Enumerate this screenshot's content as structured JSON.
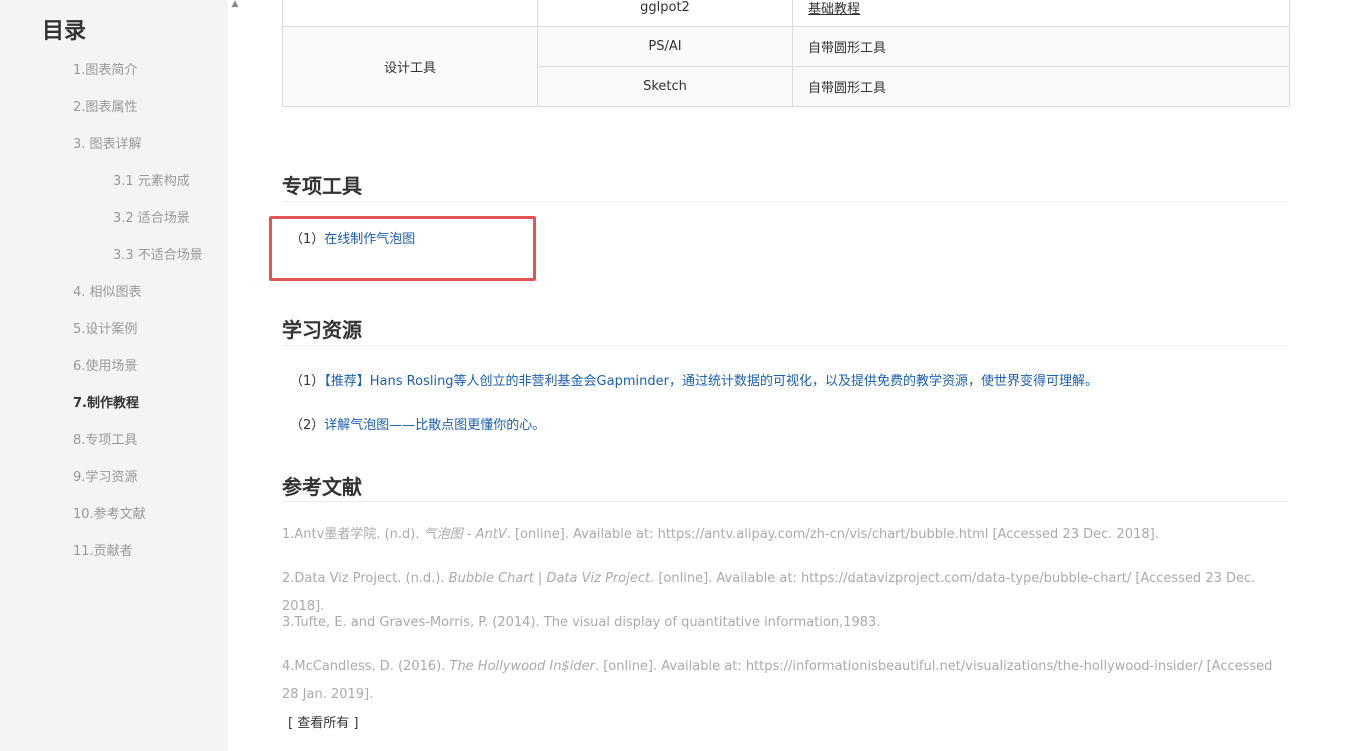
{
  "sidebar": {
    "title": "目录",
    "items": [
      {
        "label": "1.图表简介"
      },
      {
        "label": "2.图表属性"
      },
      {
        "label": "3. 图表详解"
      },
      {
        "label": "3.1 元素构成"
      },
      {
        "label": "3.2 适合场景"
      },
      {
        "label": "3.3 不适合场景"
      },
      {
        "label": "4. 相似图表"
      },
      {
        "label": "5.设计案例"
      },
      {
        "label": "6.使用场景"
      },
      {
        "label": "7.制作教程"
      },
      {
        "label": "8.专项工具"
      },
      {
        "label": "9.学习资源"
      },
      {
        "label": "10.参考文献"
      },
      {
        "label": "11.贡献者"
      }
    ],
    "scroll_up_glyph": "▲"
  },
  "tools_table": {
    "rows": [
      {
        "category": "",
        "tool": "gglpot2",
        "resource": "基础教程"
      },
      {
        "category": "设计工具",
        "tool": "PS/AI",
        "resource": "自带圆形工具"
      },
      {
        "category": "",
        "tool": "Sketch",
        "resource": "自带圆形工具"
      }
    ]
  },
  "special_tools": {
    "heading": "专项工具",
    "items": [
      {
        "prefix": "（1）",
        "link": "在线制作气泡图"
      }
    ]
  },
  "learning": {
    "heading": "学习资源",
    "items": [
      {
        "prefix": "（1）",
        "link": "【推荐】Hans Rosling等人创立的非营利基金会Gapminder，通过统计数据的可视化，以及提供免费的教学资源，使世界变得可理解。"
      },
      {
        "prefix": "（2）",
        "link": "详解气泡图——比散点图更懂你的心。"
      }
    ]
  },
  "references": {
    "heading": "参考文献",
    "items": [
      {
        "before": "1.Antv墨者学院. (n.d). ",
        "italic": "气泡图 - AntV",
        "after": ". [online]. Available at: https://antv.alipay.com/zh-cn/vis/chart/bubble.html [Accessed 23 Dec. 2018]."
      },
      {
        "before": "2.Data Viz Project. (n.d.). ",
        "italic": "Bubble Chart | Data Viz Project",
        "after": ". [online]. Available at: https://datavizproject.com/data-type/bubble-chart/ [Accessed 23 Dec. 2018]."
      },
      {
        "before": "3.Tufte, E. and Graves-Morris, P. (2014). The visual display of quantitative information,1983.",
        "italic": "",
        "after": ""
      },
      {
        "before": "4.McCandless, D. (2016). ",
        "italic": "The Hollywood In$ider",
        "after": ". [online]. Available at: https://informationisbeautiful.net/visualizations/the-hollywood-insider/ [Accessed 28 Jan. 2019]."
      }
    ],
    "see_all": "[ 查看所有 ]"
  },
  "colors": {
    "link": "#1a5fb4",
    "highlight": "#e05555",
    "sidebar_bg": "#f4f4f4"
  }
}
